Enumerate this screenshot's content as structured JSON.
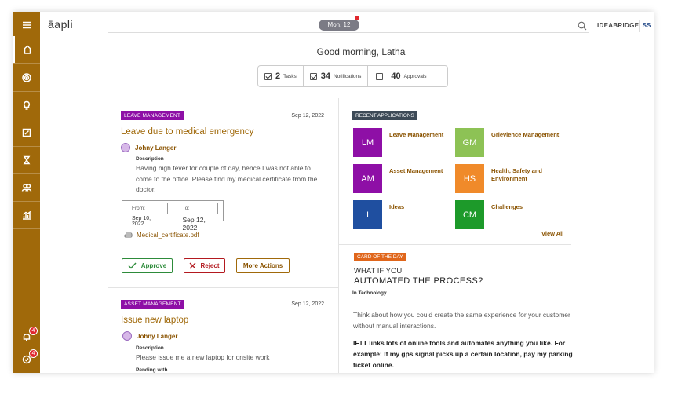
{
  "app": {
    "logo": "āapli",
    "date": "Mon, 12",
    "org": "IDEABRIDGE",
    "user_initials": "SS"
  },
  "greeting": "Good morning, Latha",
  "stats": [
    {
      "count": "2",
      "label": "Tasks",
      "checked": true
    },
    {
      "count": "34",
      "label": "Notifications",
      "checked": true
    },
    {
      "count": "40",
      "label": "Approvals",
      "checked": false
    }
  ],
  "sidebar": {
    "items": [
      "menu-icon",
      "home-icon",
      "target-icon",
      "lightbulb-icon",
      "edit-icon",
      "trophy-icon",
      "people-icon",
      "chart-icon"
    ],
    "notifications_badge": "4",
    "approvals_badge": "4"
  },
  "cards": [
    {
      "tag": "LEAVE MANAGEMENT",
      "date": "Sep 12, 2022",
      "title": "Leave due to medical emergency",
      "person": "Johny Langer",
      "desc_label": "Description",
      "desc": "Having high fever for couple of day, hence I was not able to come to the office. Please find my medical certificate from the doctor.",
      "from_label": "From:",
      "from": "Sep 10, 2022",
      "to_label": "To:",
      "to": "Sep 12, 2022",
      "attachment": "Medical_certificate.pdf",
      "approve": "Approve",
      "reject": "Reject",
      "more": "More Actions"
    },
    {
      "tag": "ASSET MANAGEMENT",
      "date": "Sep 12, 2022",
      "title": "Issue new laptop",
      "person": "Johny Langer",
      "desc_label": "Description",
      "desc": "Please issue me a new laptop for onsite work",
      "pending_label": "Pending with"
    }
  ],
  "recent": {
    "tag": "RECENT APPLICATIONS",
    "apps": [
      {
        "abbr": "LM",
        "name": "Leave Management",
        "color": "#8e0fa6"
      },
      {
        "abbr": "GM",
        "name": "Grievience Management",
        "color": "#8dc255"
      },
      {
        "abbr": "AM",
        "name": "Asset Management",
        "color": "#8e0fa6"
      },
      {
        "abbr": "HS",
        "name": "Health, Safety and Environment",
        "color": "#f08a2a"
      },
      {
        "abbr": "I",
        "name": "Ideas",
        "color": "#1f4fa0"
      },
      {
        "abbr": "CM",
        "name": "Challenges",
        "color": "#1d9a2a"
      }
    ],
    "view_all": "View All"
  },
  "card_of_day": {
    "tag": "CARD OF THE DAY",
    "line1": "WHAT IF YOU",
    "line2": "AUTOMATED THE PROCESS?",
    "category": "In Technology",
    "p1": "Think about how you could create the same experience for your customer without manual interactions.",
    "p2": "IFTT links lots of online tools and automates anything you like. For example: If my gps signal picks up a certain location, pay my parking ticket online."
  },
  "colors": {
    "brand": "#a0690a",
    "accent_text": "#8a5300",
    "tag_purple": "#8e0fa6",
    "tag_dark": "#3d4a57",
    "tag_orange": "#e0661b"
  }
}
